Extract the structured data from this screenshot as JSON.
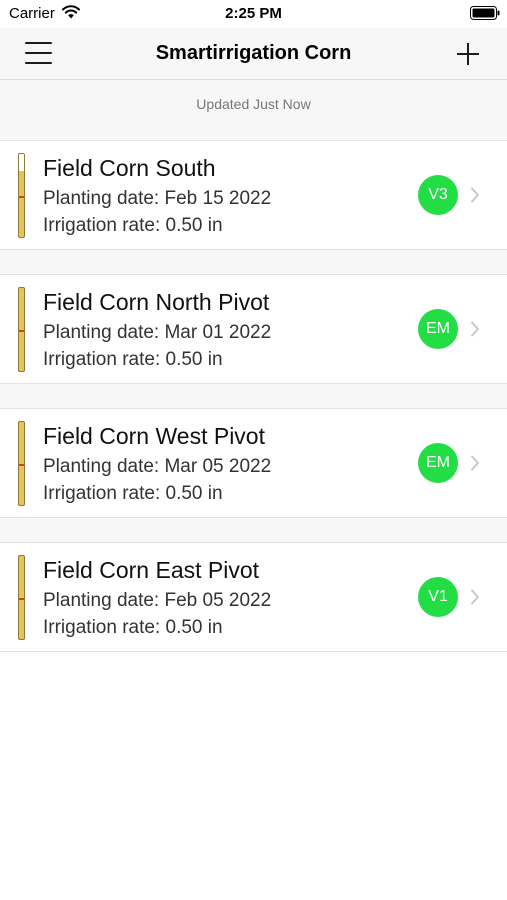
{
  "status_bar": {
    "carrier": "Carrier",
    "time": "2:25 PM"
  },
  "nav": {
    "title": "Smartirrigation Corn",
    "menu_icon": "hamburger-icon",
    "add_icon": "plus-icon"
  },
  "header": {
    "updated": "Updated Just Now"
  },
  "colors": {
    "badge": "#22dd44",
    "growth_bar": "#e8c25a",
    "marker": "#d83b2b",
    "chevron": "#c7c7cc"
  },
  "fields": [
    {
      "name": "Field Corn South",
      "planting": "Planting date: Feb 15 2022",
      "irrigation": "Irrigation rate: 0.50 in",
      "stage": "V3",
      "empty_fraction": 0.2
    },
    {
      "name": "Field Corn North Pivot",
      "planting": "Planting date: Mar 01 2022",
      "irrigation": "Irrigation rate: 0.50 in",
      "stage": "EM",
      "empty_fraction": 0
    },
    {
      "name": "Field Corn West Pivot",
      "planting": "Planting date: Mar 05 2022",
      "irrigation": "Irrigation rate: 0.50 in",
      "stage": "EM",
      "empty_fraction": 0
    },
    {
      "name": "Field Corn East Pivot",
      "planting": "Planting date: Feb 05 2022",
      "irrigation": "Irrigation rate: 0.50 in",
      "stage": "V1",
      "empty_fraction": 0
    }
  ]
}
